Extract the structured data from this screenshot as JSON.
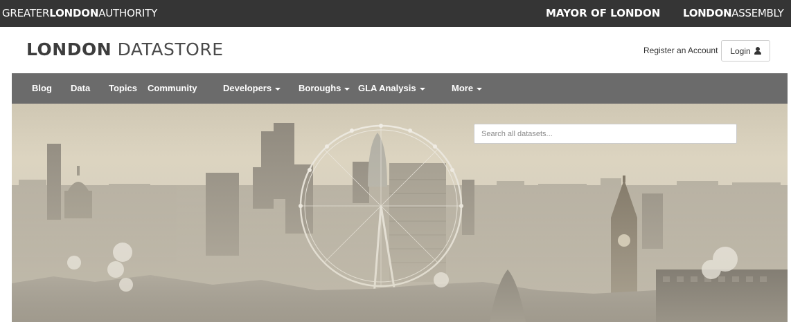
{
  "gla_bar": {
    "left_prefix": "GREATER",
    "left_bold": "LONDON",
    "left_suffix": "AUTHORITY",
    "mayor": "MAYOR OF LONDON",
    "assembly_bold": "LONDON",
    "assembly_suffix": "ASSEMBLY"
  },
  "header": {
    "logo_bold": "LONDON",
    "logo_light": "DATASTORE",
    "register_label": "Register an Account",
    "login_label": "Login",
    "login_icon": "user-icon"
  },
  "nav": {
    "items": [
      {
        "label": "Blog",
        "dropdown": false
      },
      {
        "label": "Data",
        "dropdown": false
      },
      {
        "label": "Topics",
        "dropdown": false
      },
      {
        "label": "Community",
        "dropdown": false
      },
      {
        "label": "Developers",
        "dropdown": true
      },
      {
        "label": "Boroughs",
        "dropdown": true
      },
      {
        "label": "GLA Analysis",
        "dropdown": true
      },
      {
        "label": "More",
        "dropdown": true
      }
    ]
  },
  "hero": {
    "search_placeholder": "Search all datasets..."
  },
  "colors": {
    "top_bar": "#353535",
    "nav_bar": "#6b6b6b",
    "logo_text": "#3d3d3d"
  }
}
